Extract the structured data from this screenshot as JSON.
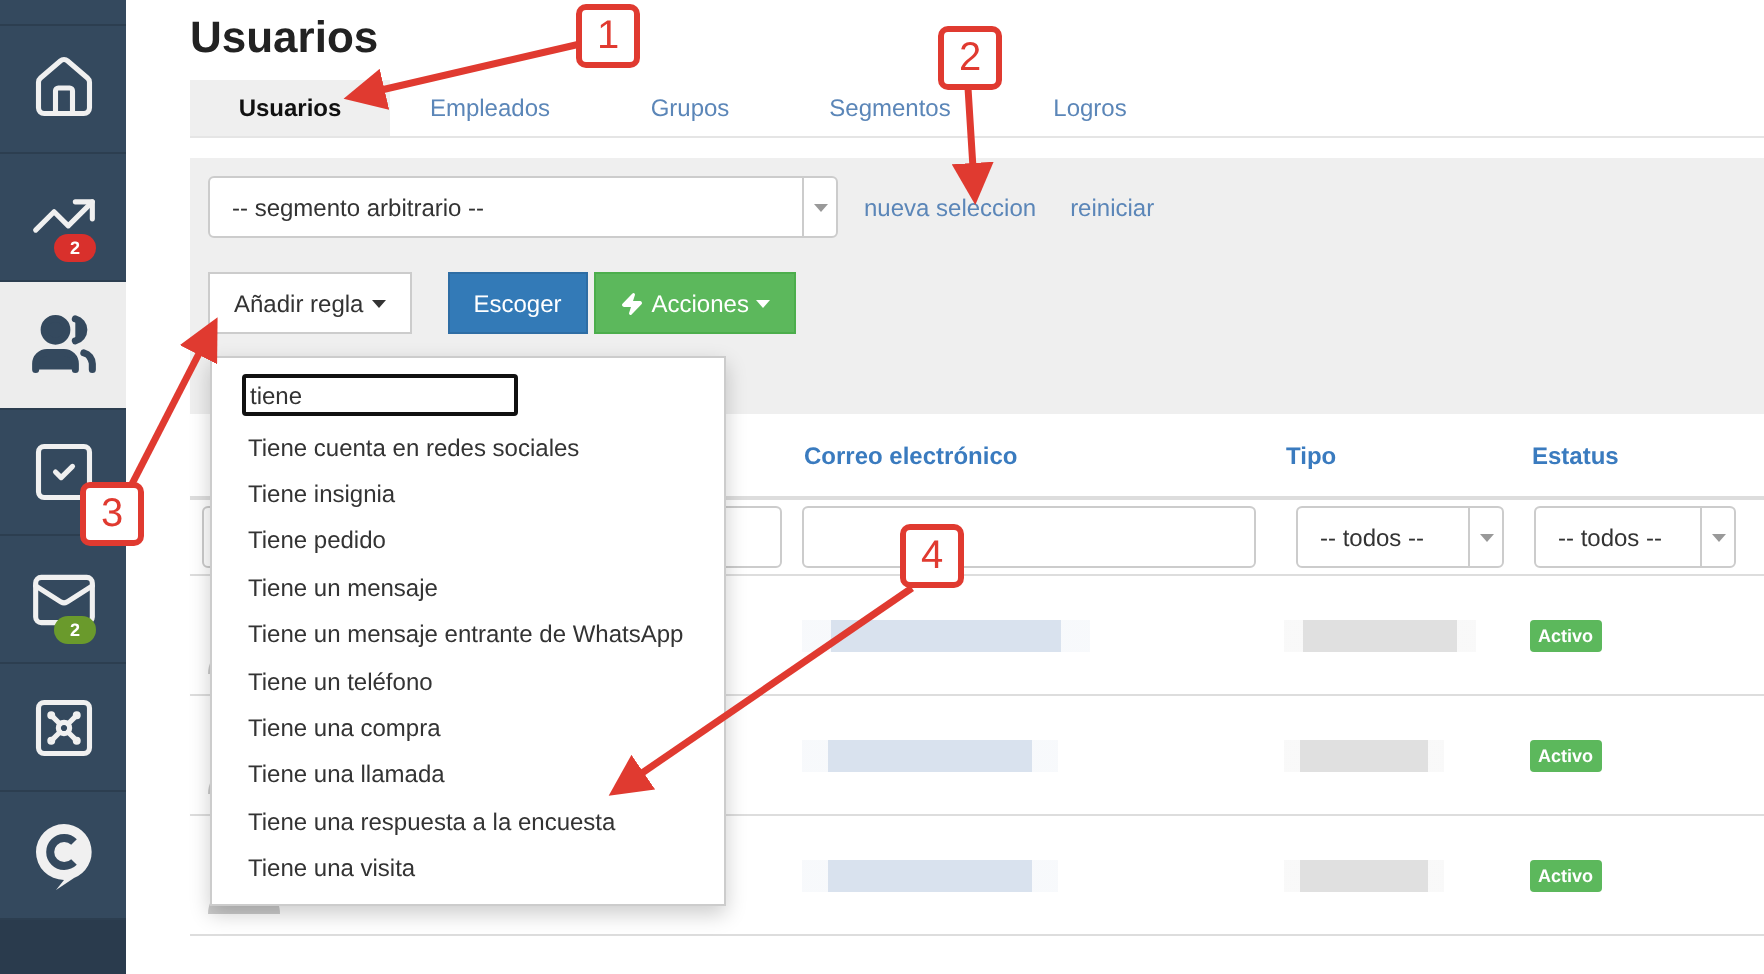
{
  "sidebar": {
    "items": [
      {
        "selected": false
      },
      {
        "selected": false,
        "badge": "2",
        "color": "#d9302c"
      },
      {
        "selected": true
      },
      {
        "selected": false
      },
      {
        "selected": false,
        "badge": "2",
        "color": "#6a9a2c"
      },
      {
        "selected": false
      },
      {
        "selected": false
      }
    ]
  },
  "title": "Usuarios",
  "tabs": [
    {
      "label": "Usuarios",
      "selected": true
    },
    {
      "label": "Empleados",
      "selected": false
    },
    {
      "label": "Grupos",
      "selected": false
    },
    {
      "label": "Segmentos",
      "selected": false
    },
    {
      "label": "Logros",
      "selected": false
    }
  ],
  "segment_select": {
    "value": "-- segmento arbitrario --"
  },
  "links": [
    "nueva seleccion",
    "reiniciar"
  ],
  "buttons": [
    {
      "label": "Añadir regla",
      "kind": "dropdown"
    },
    {
      "label": "Escoger",
      "kind": "primary"
    },
    {
      "label": "Acciones",
      "kind": "success"
    }
  ],
  "rule_menu": {
    "search": "tiene",
    "items": [
      "Tiene cuenta en redes sociales",
      "Tiene insignia",
      "Tiene pedido",
      "Tiene un mensaje",
      "Tiene un mensaje entrante de WhatsApp",
      "Tiene un teléfono",
      "Tiene una compra",
      "Tiene una llamada",
      "Tiene una respuesta a la encuesta",
      "Tiene una visita"
    ]
  },
  "table": {
    "columns": [
      "Correo electrónico",
      "Tipo",
      "Estatus"
    ],
    "filters": [
      "-- todos --",
      "-- todos --"
    ],
    "rows": [
      {
        "status": "Activo"
      },
      {
        "status": "Activo"
      },
      {
        "status": "Activo"
      }
    ]
  },
  "annotations": [
    "1",
    "2",
    "3",
    "4"
  ]
}
